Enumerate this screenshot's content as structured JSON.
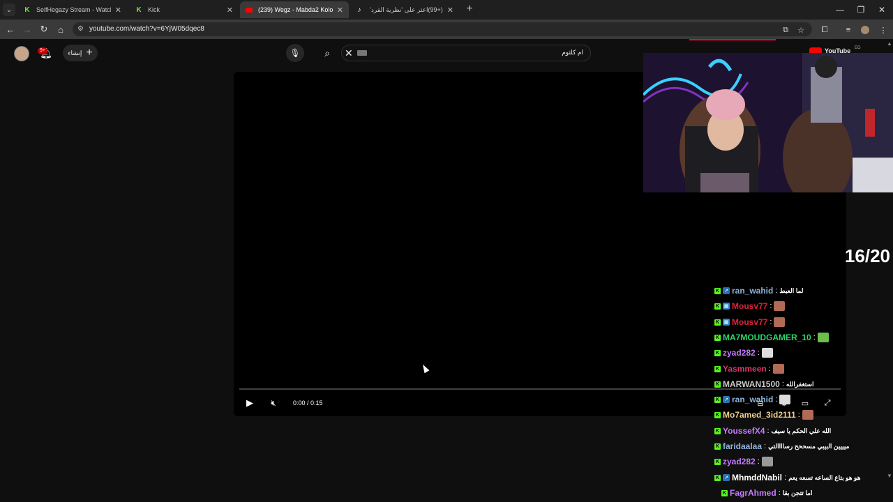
{
  "browser": {
    "tabs": [
      {
        "title": "SeifHegazy Stream - Watch Live",
        "favicon": "kick-icon",
        "active": false
      },
      {
        "title": "Kick",
        "favicon": "kick-icon",
        "active": false
      },
      {
        "title": "(239) Wegz - Mabda2 Kolo Btamn",
        "favicon": "youtube-icon",
        "active": true
      },
      {
        "title": "(+99)اعثر على 'نظرية القرد' على",
        "favicon": "tiktok-icon",
        "active": false
      }
    ],
    "url": "youtube.com/watch?v=6YjW05dqec8"
  },
  "youtube_header": {
    "notification_count": "9+",
    "create_label": "إنشاء",
    "search_value": "ام كلثوم",
    "logo_text": "YouTube",
    "region": "EG"
  },
  "player": {
    "time": "0:00 / 0:15",
    "progress": 0
  },
  "overlay": {
    "counter": "16/20",
    "chat": [
      {
        "user": "ran_wahid",
        "color": "#8fb3d9",
        "badge": "sub-blue",
        "message": "لما العبط",
        "emote": null
      },
      {
        "user": "Mousv77",
        "color": "#e0233d",
        "badge": "sub-multi",
        "message": "",
        "emote": "#b06a55"
      },
      {
        "user": "Mousv77",
        "color": "#e0233d",
        "badge": "sub-multi",
        "message": "",
        "emote": "#b06a55"
      },
      {
        "user": "MA7MOUDGAMER_10",
        "color": "#2ed36b",
        "badge": null,
        "message": "",
        "emote": "#6bbf4a"
      },
      {
        "user": "zyad282",
        "color": "#c77dff",
        "badge": null,
        "message": "",
        "emote": "#dddddd"
      },
      {
        "user": "Yasmmeen",
        "color": "#e0336b",
        "badge": null,
        "message": "",
        "emote": "#b06a55"
      },
      {
        "user": "MARWAN1500",
        "color": "#c9c9c9",
        "badge": null,
        "message": "استغفرالله",
        "emote": null
      },
      {
        "user": "ran_wahid",
        "color": "#8fb3d9",
        "badge": "sub-blue",
        "message": "",
        "emote": "#dddddd"
      },
      {
        "user": "Mo7amed_3id2111",
        "color": "#f0d08a",
        "badge": null,
        "message": "",
        "emote": "#b06a55"
      },
      {
        "user": "YoussefX4",
        "color": "#c77dff",
        "badge": null,
        "message": "الله علي الحكم يا سيف",
        "emote": null
      },
      {
        "user": "faridaalaa",
        "color": "#8fb3d9",
        "badge": null,
        "message": "ميييين البيبي مسححح رساااالتي",
        "emote": null
      },
      {
        "user": "zyad282",
        "color": "#c77dff",
        "badge": null,
        "message": "",
        "emote": "#9a9a9a"
      },
      {
        "user": "MhmddNabil",
        "color": "#ffffff",
        "badge": "sub-blue",
        "message": "هو هو بتاع الساعه تسعه يعم",
        "emote": null
      },
      {
        "user": "FagrAhmed",
        "color": "#c77dff",
        "badge": null,
        "message": "اما تتجن بقا",
        "emote": null
      }
    ]
  },
  "colors": {
    "youtube_red": "#ff0000",
    "kick_green": "#53fc18",
    "page_bg": "#0f0f0f"
  }
}
